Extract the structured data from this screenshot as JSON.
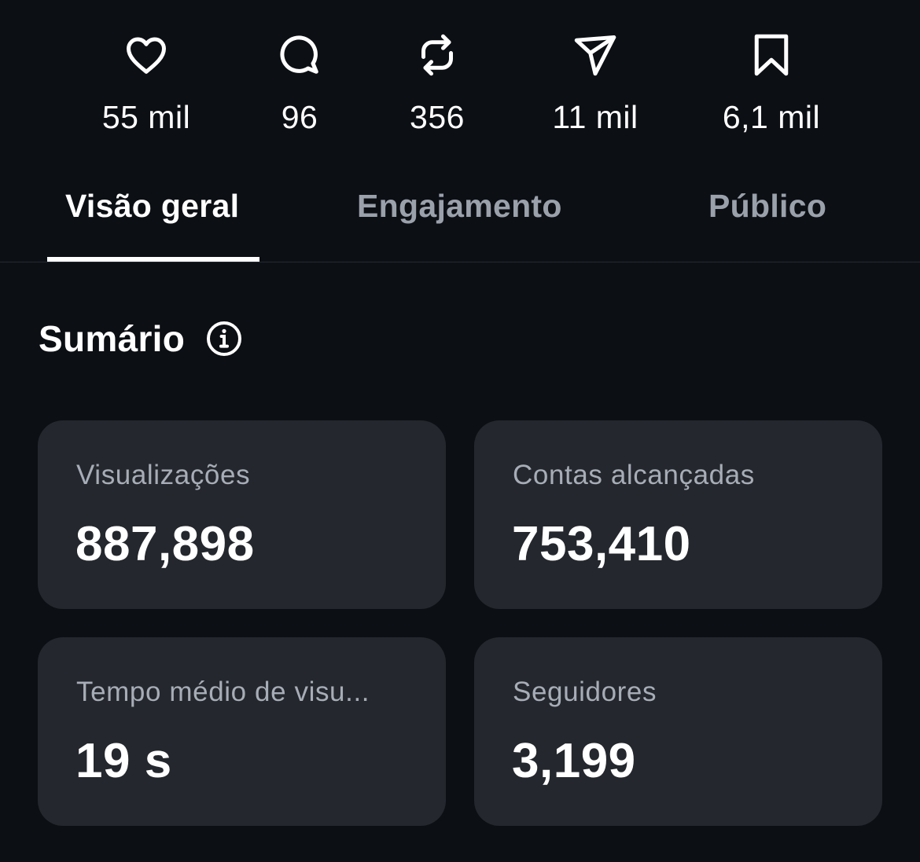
{
  "stats": [
    {
      "icon": "heart-icon",
      "value": "55 mil"
    },
    {
      "icon": "comment-icon",
      "value": "96"
    },
    {
      "icon": "repost-icon",
      "value": "356"
    },
    {
      "icon": "share-icon",
      "value": "11 mil"
    },
    {
      "icon": "bookmark-icon",
      "value": "6,1 mil"
    }
  ],
  "tabs": [
    {
      "label": "Visão geral",
      "active": true
    },
    {
      "label": "Engajamento",
      "active": false
    },
    {
      "label": "Público",
      "active": false
    }
  ],
  "summary": {
    "title": "Sumário",
    "info_icon": "info-icon",
    "cards": [
      {
        "label": "Visualizações",
        "value": "887,898"
      },
      {
        "label": "Contas alcançadas",
        "value": "753,410"
      },
      {
        "label": "Tempo médio de visu...",
        "value": "19 s"
      },
      {
        "label": "Seguidores",
        "value": "3,199"
      }
    ]
  },
  "colors": {
    "background": "#0c0f14",
    "card": "#24272d",
    "text_primary": "#ffffff",
    "text_secondary": "#a7adb6"
  }
}
